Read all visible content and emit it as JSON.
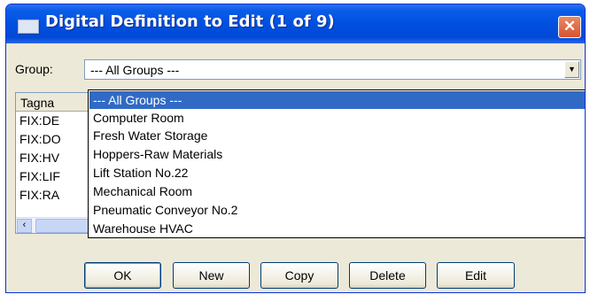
{
  "window": {
    "title": "Digital Definition to Edit (1 of 9)",
    "close_glyph": "✕"
  },
  "group": {
    "label": "Group:",
    "value": "--- All Groups ---",
    "options": [
      "--- All Groups ---",
      "Computer Room",
      "Fresh Water Storage",
      "Hoppers-Raw Materials",
      "Lift Station No.22",
      "Mechanical Room",
      "Pneumatic Conveyor No.2",
      "Warehouse HVAC"
    ],
    "selected_index": 0
  },
  "list": {
    "header": "Tagna",
    "rows": [
      "FIX:DE",
      "FIX:DO",
      "FIX:HV",
      "FIX:LIF",
      "FIX:RA"
    ]
  },
  "buttons": {
    "ok": "OK",
    "new": "New",
    "copy": "Copy",
    "delete": "Delete",
    "edit": "Edit"
  },
  "colors": {
    "titlebar": "#0050e0",
    "selection": "#316ac5",
    "face": "#ece9d8"
  }
}
